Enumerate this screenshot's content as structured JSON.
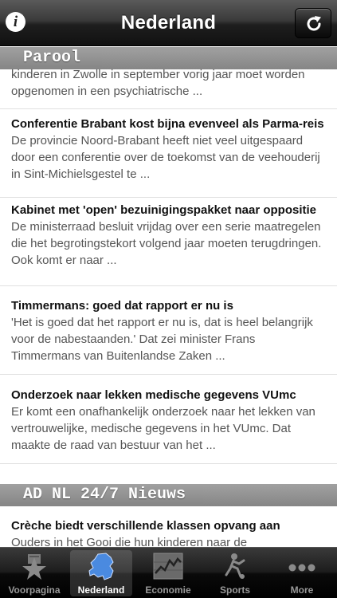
{
  "navbar": {
    "title": "Nederland",
    "info_glyph": "i",
    "info_icon": "info-icon",
    "refresh_icon": "refresh-icon"
  },
  "sections": [
    {
      "header": "Parool",
      "partial_desc": "kinderen in Zwolle in september vorig jaar moet worden opgenomen in een psychiatrische ..."
    }
  ],
  "articles": [
    {
      "title": "Conferentie Brabant kost bijna evenveel als Parma-reis",
      "desc": "De provincie Noord-Brabant heeft niet veel uitgespaard door een conferentie over de toekomst van de veehouderij in Sint-Michielsgestel te ..."
    },
    {
      "title": "Kabinet met 'open' bezuinigingspakket naar oppositie",
      "desc": "De ministerraad besluit vrijdag over een serie maatregelen die het begrotingstekort volgend jaar moeten terugdringen. Ook komt er naar ..."
    },
    {
      "title": "Timmermans: goed dat rapport er nu is",
      "desc": "'Het is goed dat het rapport er nu is, dat is heel belangrijk voor de nabestaanden.' Dat zei minister Frans Timmermans van Buitenlandse Zaken ..."
    },
    {
      "title": "Onderzoek naar lekken medische gegevens VUmc",
      "desc": "Er komt een onafhankelijk onderzoek naar het lekken van vertrouwelijke, medische gegevens in het VUmc. Dat maakte de raad van bestuur van het ..."
    }
  ],
  "section2": {
    "header": "AD NL 24/7 Nieuws",
    "article": {
      "title": "Crèche biedt verschillende klassen opvang aan",
      "desc": "Ouders in het Gooi die hun kinderen naar de"
    }
  },
  "tabs": [
    {
      "label": "Voorpagina",
      "icon": "star-icon",
      "active": false
    },
    {
      "label": "Nederland",
      "icon": "netherlands-map-icon",
      "active": true
    },
    {
      "label": "Economie",
      "icon": "stock-chart-icon",
      "active": false
    },
    {
      "label": "Sports",
      "icon": "sports-player-icon",
      "active": false
    },
    {
      "label": "More",
      "icon": "more-dots-icon",
      "active": false
    }
  ],
  "colors": {
    "navbar": "#1e1e1e",
    "section_header": "#8a8a8a",
    "tab_active_icon": "#3f7fd6"
  }
}
